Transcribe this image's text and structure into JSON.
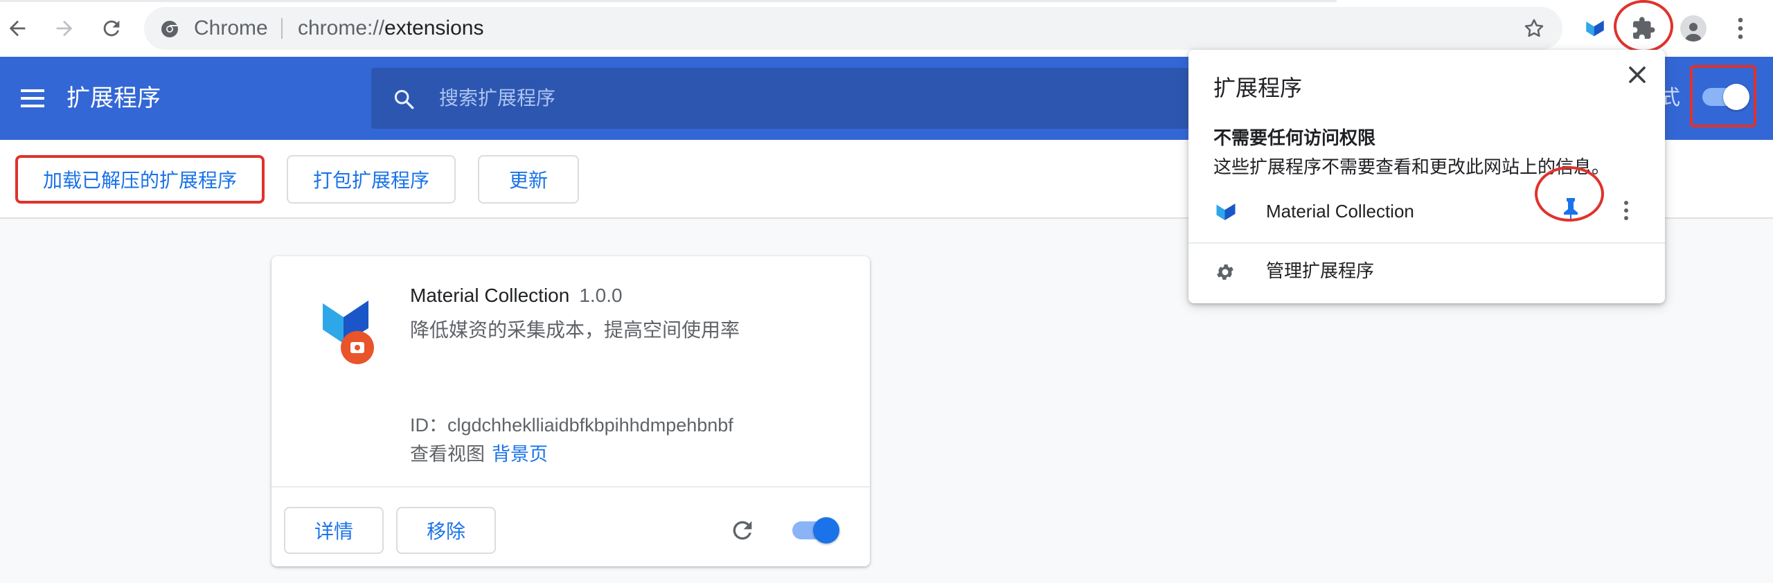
{
  "browser": {
    "chip_label": "Chrome",
    "url_scheme": "chrome://",
    "url_path": "extensions"
  },
  "header": {
    "title": "扩展程序",
    "search_placeholder": "搜索扩展程序",
    "devmode_label_partial": "式",
    "devmode_enabled": true
  },
  "actions": {
    "load_unpacked": "加载已解压的扩展程序",
    "pack": "打包扩展程序",
    "update": "更新"
  },
  "extension_card": {
    "name": "Material Collection",
    "version": "1.0.0",
    "description": "降低媒资的采集成本，提高空间使用率",
    "id_text": "ID：clgdchheklliaidbfkbpihhdmpehbnbf",
    "inspect_label": "查看视图",
    "inspect_link": "背景页",
    "details_button": "详情",
    "remove_button": "移除",
    "enabled": true
  },
  "popup": {
    "title": "扩展程序",
    "section_title": "不需要任何访问权限",
    "section_desc": "这些扩展程序不需要查看和更改此网站上的信息。",
    "extension_name": "Material Collection",
    "manage_label": "管理扩展程序"
  },
  "colors": {
    "header_blue": "#3367d6",
    "accent_blue": "#1a73e8",
    "highlight_red": "#e0322c"
  }
}
